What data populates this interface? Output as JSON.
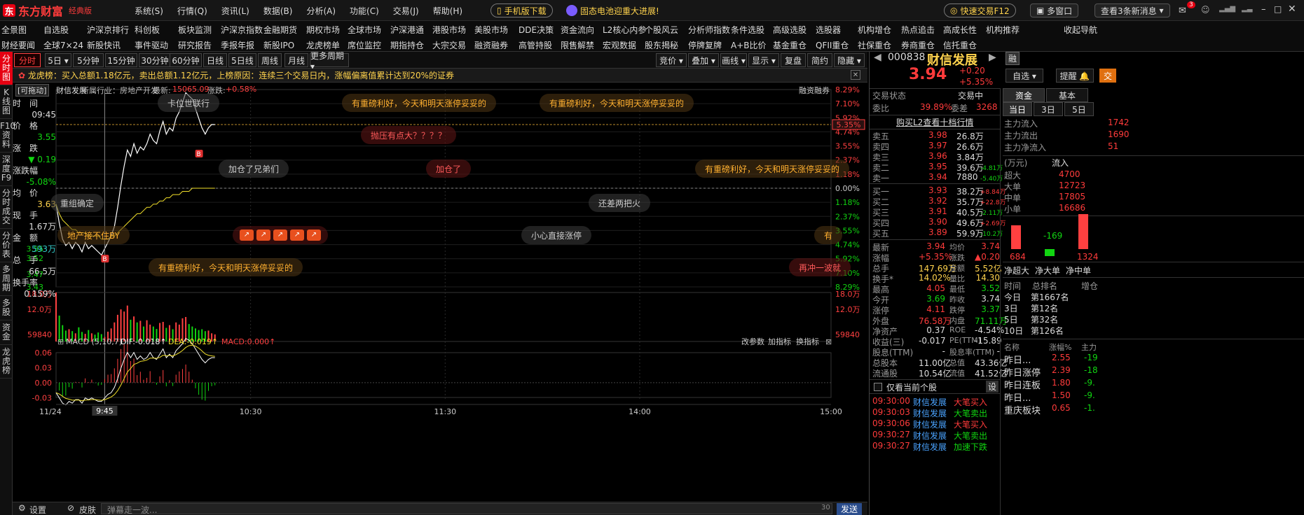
{
  "app": {
    "logo_mark": "东",
    "name": "东方财富",
    "edition": "经典版"
  },
  "menu": [
    "系统(S)",
    "行情(Q)",
    "资讯(L)",
    "数据(B)",
    "分析(A)",
    "功能(C)",
    "交易(J)",
    "帮助(H)"
  ],
  "top_pills": {
    "mobile": "手机版下载",
    "news": "固态电池迎重大进展!",
    "quick_trade": "快速交易F12",
    "multi_window": "多窗口",
    "new_msgs": "查看3条新消息",
    "msg_badge": "3"
  },
  "nav_row1": [
    "全景图",
    "自选股",
    "沪深京排行",
    "科创板",
    "板块监测",
    "沪深京指数",
    "金融期货",
    "期权市场",
    "全球市场",
    "沪深港通",
    "港股市场",
    "美股市场",
    "DDE决策",
    "资金流向",
    "L2核心内参",
    "个股风云",
    "分析师指数",
    "条件选股",
    "高级选股",
    "选股器",
    "机构增仓",
    "热点追击",
    "高成长性",
    "机构推荐",
    "收起导航"
  ],
  "nav_row2": [
    "财经要闻",
    "全球7×24",
    "新股快讯",
    "事件驱动",
    "研究报告",
    "季报年报",
    "新股IPO",
    "龙虎榜单",
    "席位监控",
    "期指持仓",
    "大宗交易",
    "融资融券",
    "高管持股",
    "限售解禁",
    "宏观数据",
    "股东揭秘",
    "停牌复牌",
    "A+B比价",
    "基金重仓",
    "QFII重仓",
    "社保重仓",
    "券商重仓",
    "信托重仓"
  ],
  "left_tabs": [
    "分时图",
    "K线图",
    "F10资料",
    "深度F9",
    "分时成交",
    "分价表",
    "多周期",
    "多股",
    "资金",
    "龙虎榜"
  ],
  "period_tabs": [
    "分时",
    "5日",
    "5分钟",
    "15分钟",
    "30分钟",
    "60分钟",
    "日线",
    "5日线",
    "周线",
    "月线",
    "更多周期"
  ],
  "right_tabs": [
    "竞价",
    "叠加",
    "画线",
    "显示",
    "复盘",
    "简约",
    "隐藏"
  ],
  "dragon_bar": "龙虎榜：买入总额1.18亿元，卖出总额1.12亿元，上榜原因：连续三个交易日内，涨幅偏离值累计达到20%的证券",
  "chart_header": {
    "draggable": "[可拖动]",
    "stock": "财信发展",
    "industry": "所属行业：房地产开发",
    "index_label": "最新:",
    "index_value": "15065.09",
    "chg_label": "涨跌:",
    "chg_value": "+0.58%",
    "margin": "融资融券"
  },
  "info": {
    "time_label": "时　间",
    "time": "09:45",
    "price_label": "价　格",
    "price": "3.55",
    "chg_label": "涨　跌",
    "chg": "▼ 0.19",
    "pct_label": "涨跌幅",
    "pct": "-5.08%",
    "avg_label": "均　价",
    "avg": "3.63",
    "vol_label": "现　手",
    "vol": "1.67万",
    "amt_label": "金　额",
    "amt": "593万",
    "tot_label": "总　手",
    "tot": "66.5万",
    "turn_label": "换手率",
    "turn": "0.159%"
  },
  "y_left": [
    "3.55",
    "3.52",
    "3.47",
    "3.43"
  ],
  "y_right": [
    "8.29%",
    "7.10%",
    "5.92%",
    "4.74%",
    "3.55%",
    "2.37%",
    "1.18%",
    "0.00%",
    "1.18%",
    "2.37%",
    "3.55%",
    "4.74%",
    "5.92%",
    "7.10%",
    "8.29%"
  ],
  "last_pct": "5.35%",
  "vol_axis": [
    "18.0万",
    "12.0万",
    "59840"
  ],
  "macd": {
    "title": "MACD (5,10,7)",
    "dif": "DIF:-0.018↑",
    "dea": "DEA:-0.019↑",
    "macd": "MACD:0.000↑",
    "btns": [
      "改参数",
      "加指标",
      "换指标"
    ],
    "axis": [
      "0.06",
      "0.03",
      "0.00",
      "-0.03"
    ]
  },
  "x_axis": {
    "date": "11/24",
    "cur": "9:45",
    "t1": "10:30",
    "t2": "11:30",
    "t3": "14:00",
    "t4": "15:00"
  },
  "comments": [
    {
      "t": "卡位世联行",
      "c": ""
    },
    {
      "t": "有重磅利好，今天和明天涨停妥妥的",
      "c": "y"
    },
    {
      "t": "有重磅利好，今天和明天涨停妥妥的",
      "c": "y"
    },
    {
      "t": "抛压有点大？？？？",
      "c": "r"
    },
    {
      "t": "加仓了兄弟们",
      "c": ""
    },
    {
      "t": "加仓了",
      "c": "r"
    },
    {
      "t": "有重磅利好，今天和明天涨停妥妥的",
      "c": "y"
    },
    {
      "t": "重组确定",
      "c": ""
    },
    {
      "t": "还差两把火",
      "c": ""
    },
    {
      "t": "地产接不住BY",
      "c": "y"
    },
    {
      "t": "小心直接涨停",
      "c": ""
    },
    {
      "t": "有",
      "c": "y"
    },
    {
      "t": "有重磅利好，今天和明天涨停妥妥的",
      "c": "y"
    },
    {
      "t": "再冲一波就",
      "c": "r"
    }
  ],
  "marks": {
    "b": "B"
  },
  "bottom": {
    "settings": "设置",
    "skin": "皮肤",
    "danmu": "弹幕走一波...",
    "count": "30",
    "send": "发送"
  },
  "stock": {
    "code": "000838",
    "name": "财信发展",
    "badge": "融",
    "price": "3.94",
    "chg": "+0.20",
    "pct": "+5.35%",
    "watch": "自选",
    "remind": "提醒",
    "trade": "交"
  },
  "status": {
    "label": "交易状态",
    "value": "交易中",
    "wb_label": "委比",
    "wb": "39.89%",
    "wc_label": "委差",
    "wc": "3268",
    "l2": "购买L2查看十档行情"
  },
  "sells": [
    {
      "n": "卖五",
      "p": "3.98",
      "v": "26.8万",
      "d": ""
    },
    {
      "n": "卖四",
      "p": "3.97",
      "v": "26.6万",
      "d": ""
    },
    {
      "n": "卖三",
      "p": "3.96",
      "v": "3.84万",
      "d": ""
    },
    {
      "n": "卖二",
      "p": "3.95",
      "v": "39.6万",
      "d": "-4.81万"
    },
    {
      "n": "卖一",
      "p": "3.94",
      "v": "7880",
      "d": "-5.40万"
    }
  ],
  "buys": [
    {
      "n": "买一",
      "p": "3.93",
      "v": "38.2万",
      "d": "+8.84万"
    },
    {
      "n": "买二",
      "p": "3.92",
      "v": "35.7万",
      "d": "+22.8万"
    },
    {
      "n": "买三",
      "p": "3.91",
      "v": "40.5万",
      "d": "-2.11万"
    },
    {
      "n": "买四",
      "p": "3.90",
      "v": "49.6万",
      "d": "+2.69万"
    },
    {
      "n": "买五",
      "p": "3.89",
      "v": "59.9万",
      "d": "-10.2万"
    }
  ],
  "quote": [
    [
      "最新",
      "3.94",
      "red",
      "均价",
      "3.74",
      "red"
    ],
    [
      "涨幅",
      "+5.35%",
      "red",
      "涨跌",
      "▲0.20",
      "red"
    ],
    [
      "总手",
      "147.69万",
      "yel",
      "金额",
      "5.52亿",
      "yel"
    ],
    [
      "换手*",
      "14.02%",
      "yel",
      "量比",
      "14.30",
      "yel"
    ],
    [
      "最高",
      "4.05",
      "red",
      "最低",
      "3.52",
      "grn"
    ],
    [
      "今开",
      "3.69",
      "grn",
      "昨收",
      "3.74",
      "wht"
    ],
    [
      "涨停",
      "4.11",
      "red",
      "跌停",
      "3.37",
      "grn"
    ],
    [
      "外盘",
      "76.58万",
      "red",
      "内盘",
      "71.11万",
      "grn"
    ],
    [
      "净资产",
      "0.37",
      "wht",
      "ROE",
      "-4.54%",
      "wht"
    ],
    [
      "收益(三)",
      "-0.017",
      "wht",
      "PE(TTM)",
      "-15.89",
      "wht"
    ],
    [
      "股息(TTM)",
      "-",
      "wht",
      "股息率(TTM)",
      "-",
      "wht"
    ],
    [
      "总股本",
      "11.00亿",
      "wht",
      "总值",
      "43.36亿",
      "wht"
    ],
    [
      "流通股",
      "10.54亿",
      "wht",
      "流值",
      "41.52亿",
      "wht"
    ]
  ],
  "ticks_header": {
    "only": "仅看当前个股",
    "set": "设"
  },
  "ticks": [
    {
      "t": "09:30:00",
      "n": "财信发展",
      "a": "大笔买入",
      "c": "red"
    },
    {
      "t": "09:30:03",
      "n": "财信发展",
      "a": "大笔卖出",
      "c": "grn"
    },
    {
      "t": "09:30:06",
      "n": "财信发展",
      "a": "大笔买入",
      "c": "red"
    },
    {
      "t": "09:30:27",
      "n": "财信发展",
      "a": "大笔卖出",
      "c": "grn"
    },
    {
      "t": "09:30:27",
      "n": "财信发展",
      "a": "加速下跌",
      "c": "grn"
    }
  ],
  "fund": {
    "tabs": [
      "资金",
      "基本"
    ],
    "sub": [
      "当日",
      "3日",
      "5日"
    ],
    "rows": [
      [
        "主力流入",
        "1742"
      ],
      [
        "主力流出",
        "1690"
      ],
      [
        "主力净流入",
        "51"
      ]
    ],
    "unit": "(万元)",
    "in": "流入",
    "size": [
      [
        "超大",
        "4700"
      ],
      [
        "大单",
        "12723"
      ],
      [
        "中单",
        "17805"
      ],
      [
        "小单",
        "16686"
      ]
    ],
    "bars": [
      "684",
      "-169",
      "1324"
    ],
    "net_tabs": [
      "净超大",
      "净大单",
      "净中单"
    ],
    "rank_head": [
      "时间",
      "总排名",
      "增仓"
    ],
    "rank": [
      [
        "今日",
        "第1667名"
      ],
      [
        "3日",
        "第12名"
      ],
      [
        "5日",
        "第32名"
      ],
      [
        "10日",
        "第126名"
      ]
    ],
    "list_head": [
      "名称",
      "涨幅%",
      "主力"
    ],
    "list": [
      [
        "昨日...",
        "2.55",
        "-19"
      ],
      [
        "昨日涨停",
        "2.39",
        "-18"
      ],
      [
        "昨日连板",
        "1.80",
        "-9."
      ],
      [
        "昨日...",
        "1.50",
        "-9."
      ],
      [
        "重庆板块",
        "0.65",
        "-1."
      ]
    ]
  },
  "chart_data": {
    "type": "line",
    "title": "",
    "x": [
      "09:30",
      "09:31",
      "09:32",
      "09:33",
      "09:34",
      "09:35",
      "09:36",
      "09:37",
      "09:38",
      "09:39",
      "09:40",
      "09:41",
      "09:42",
      "09:43",
      "09:44",
      "09:45",
      "09:46",
      "09:47",
      "09:48",
      "09:49",
      "09:50",
      "09:51",
      "09:52",
      "09:53",
      "09:54",
      "09:55",
      "09:56",
      "09:57",
      "09:58",
      "09:59",
      "10:00",
      "10:01",
      "10:02",
      "10:03",
      "10:04",
      "10:05",
      "10:06",
      "10:07",
      "10:08",
      "10:09",
      "10:10",
      "10:11",
      "10:12",
      "10:13",
      "10:14",
      "10:15",
      "10:16",
      "10:17",
      "10:18",
      "10:19"
    ],
    "series": [
      {
        "name": "价格",
        "values": [
          3.69,
          3.63,
          3.58,
          3.56,
          3.57,
          3.55,
          3.57,
          3.56,
          3.54,
          3.57,
          3.55,
          3.56,
          3.55,
          3.54,
          3.53,
          3.55,
          3.57,
          3.59,
          3.62,
          3.68,
          3.75,
          3.81,
          3.86,
          3.84,
          3.88,
          3.85,
          3.87,
          3.86,
          3.88,
          3.91,
          3.89,
          3.88,
          3.92,
          3.95,
          3.91,
          3.93,
          3.92,
          3.96,
          3.98,
          4.01,
          4.04,
          4.03,
          4.02,
          3.99,
          3.96,
          3.93,
          3.91,
          3.93,
          3.94,
          3.94
        ]
      },
      {
        "name": "均价",
        "values": [
          3.69,
          3.66,
          3.64,
          3.63,
          3.62,
          3.61,
          3.61,
          3.6,
          3.6,
          3.6,
          3.59,
          3.59,
          3.59,
          3.59,
          3.58,
          3.58,
          3.58,
          3.59,
          3.59,
          3.6,
          3.61,
          3.62,
          3.63,
          3.64,
          3.65,
          3.66,
          3.66,
          3.67,
          3.68,
          3.68,
          3.69,
          3.69,
          3.7,
          3.7,
          3.71,
          3.71,
          3.72,
          3.72,
          3.72,
          3.73,
          3.73,
          3.73,
          3.74,
          3.74,
          3.74,
          3.74,
          3.74,
          3.74,
          3.74,
          3.74
        ]
      }
    ],
    "ylim": [
      3.43,
      4.05
    ],
    "prev_close": 3.74,
    "volume": [
      180000,
      95000,
      60000,
      40000,
      45000,
      38000,
      30000,
      52000,
      35000,
      28000,
      42000,
      30000,
      25000,
      33000,
      27000,
      16700,
      36000,
      48000,
      70000,
      98000,
      118000,
      110000,
      132000,
      80000,
      92000,
      70000,
      76000,
      55000,
      78000,
      62000,
      55000,
      46000,
      68000,
      72000,
      50000,
      60000,
      45000,
      70000,
      62000,
      85000,
      90000,
      64000,
      55000,
      48000,
      42000,
      45000,
      38000,
      40000,
      30000,
      26000
    ]
  }
}
